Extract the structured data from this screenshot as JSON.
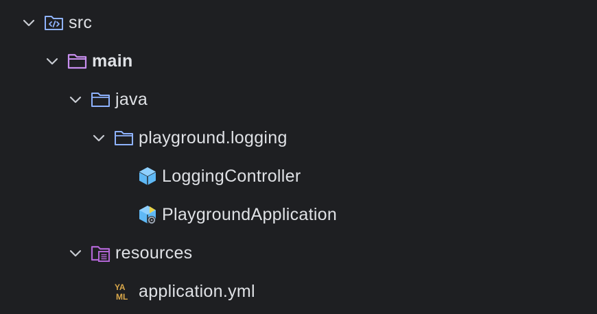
{
  "tree": {
    "items": [
      {
        "label": "src",
        "icon": "source-folder-icon",
        "expanded": true,
        "bold": false
      },
      {
        "label": "main",
        "icon": "module-folder-icon",
        "expanded": true,
        "bold": true
      },
      {
        "label": "java",
        "icon": "folder-icon",
        "expanded": true,
        "bold": false
      },
      {
        "label": "playground.logging",
        "icon": "package-folder-icon",
        "expanded": true,
        "bold": false
      },
      {
        "label": "LoggingController",
        "icon": "java-class-icon",
        "expanded": null,
        "bold": false
      },
      {
        "label": "PlaygroundApplication",
        "icon": "spring-boot-class-icon",
        "expanded": null,
        "bold": false
      },
      {
        "label": "resources",
        "icon": "resources-folder-icon",
        "expanded": true,
        "bold": false
      },
      {
        "label": "application.yml",
        "icon": "yaml-file-icon",
        "expanded": null,
        "bold": false
      }
    ]
  },
  "colors": {
    "background": "#1e1f22",
    "text": "#dfe1e5",
    "chevron": "#c9ccd3",
    "folder_blue": "#8fb3ff",
    "module_purple": "#c98ff0",
    "resources_purple": "#b366d6",
    "class_blue": "#5fb8f5",
    "spring_yellow": "#e8d34a",
    "yaml_gold": "#d9a74a"
  }
}
